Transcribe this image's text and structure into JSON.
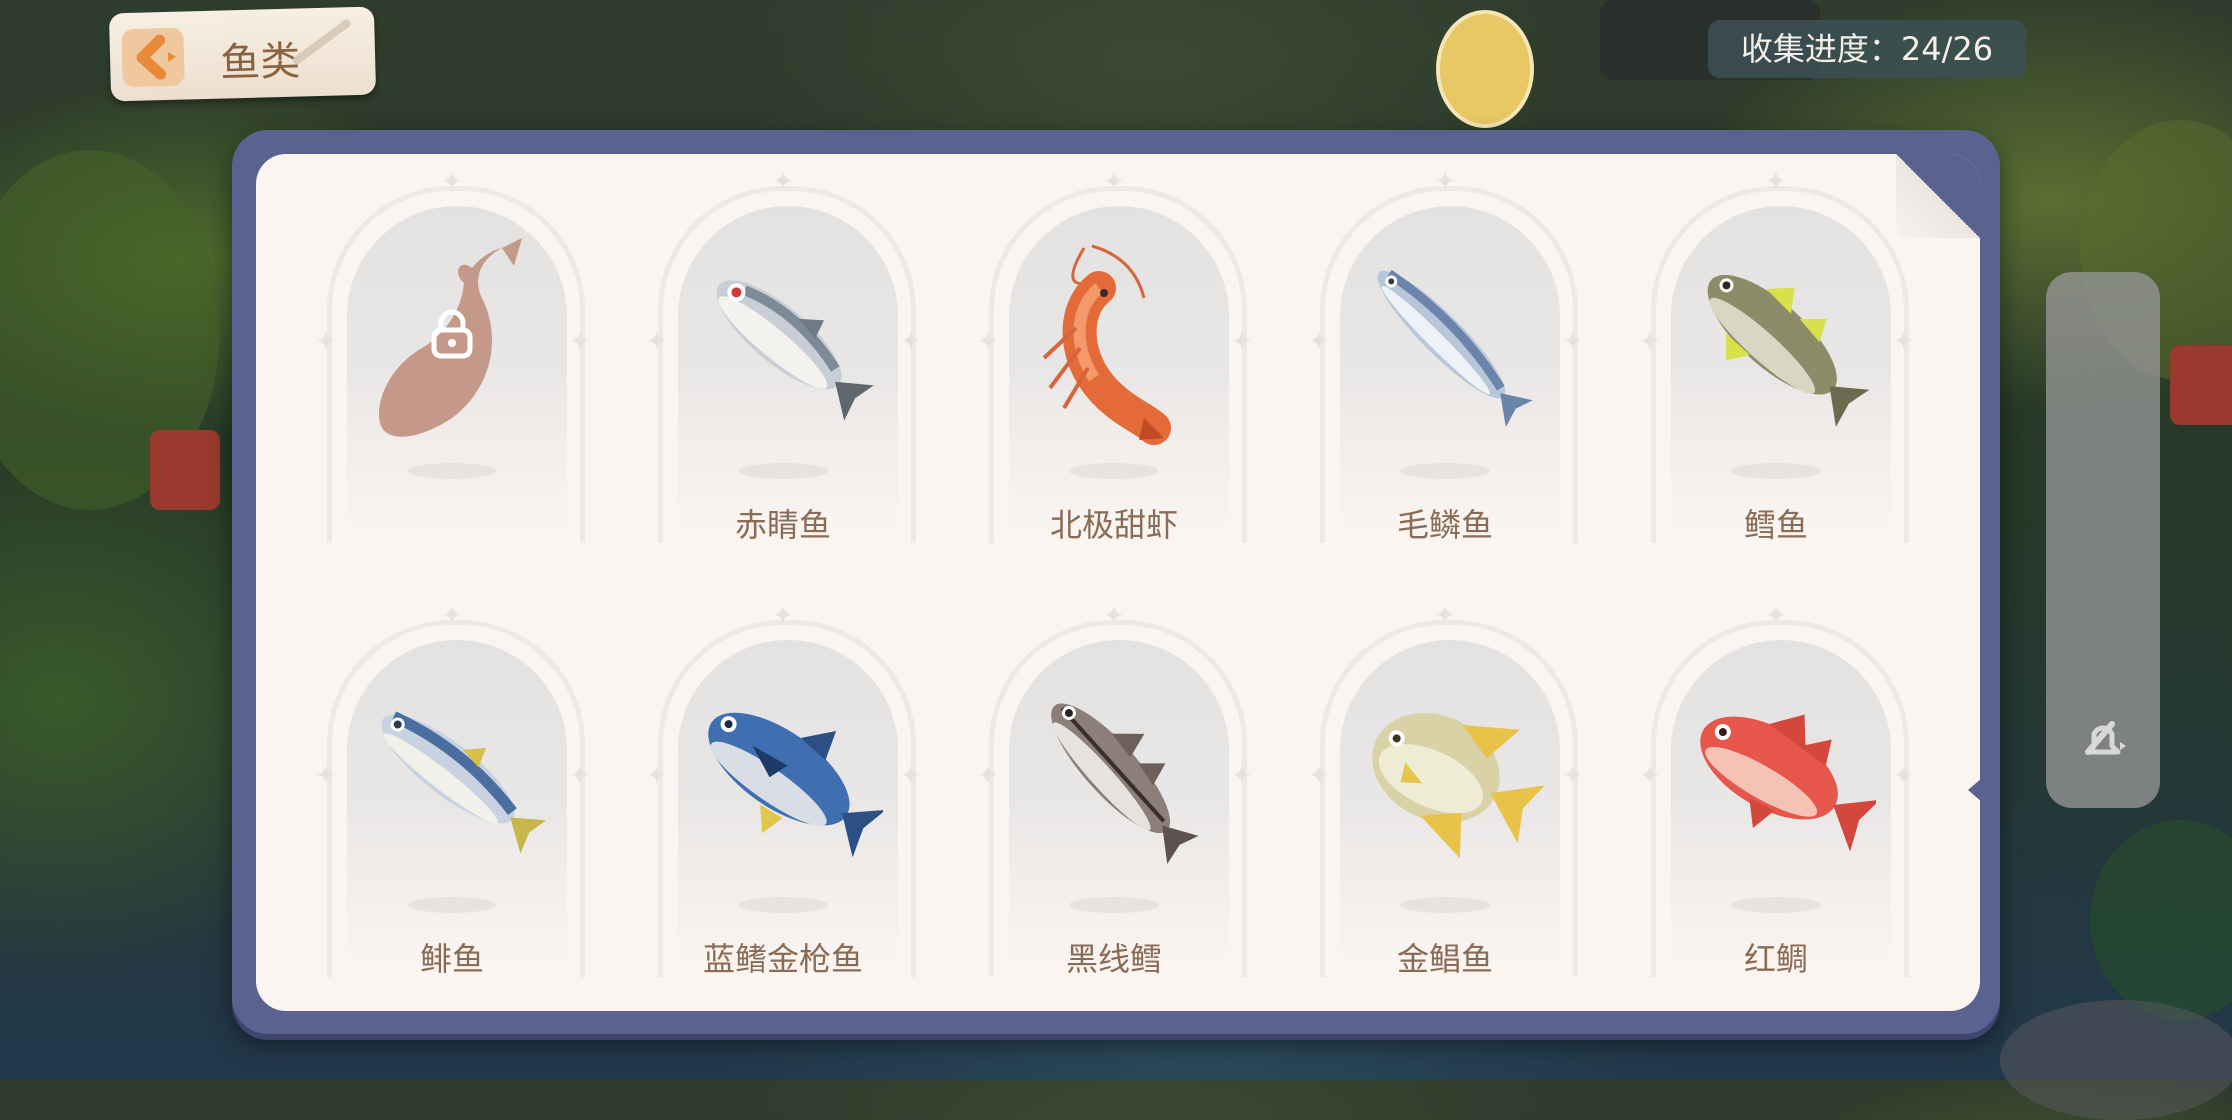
{
  "header": {
    "category_title": "鱼类",
    "progress_text": "收集进度：24/26"
  },
  "fish_cards": [
    {
      "name": "",
      "icon": "lock-icon",
      "locked": true,
      "color": "#c4998a"
    },
    {
      "name": "赤睛鱼",
      "icon": "red-eye-fish-icon",
      "locked": false,
      "color": "#9aa0a8"
    },
    {
      "name": "北极甜虾",
      "icon": "shrimp-icon",
      "locked": false,
      "color": "#e56a3a"
    },
    {
      "name": "毛鳞鱼",
      "icon": "capelin-icon",
      "locked": false,
      "color": "#7f98b8"
    },
    {
      "name": "鳕鱼",
      "icon": "cod-icon",
      "locked": false,
      "color": "#8a8a62"
    },
    {
      "name": "鲱鱼",
      "icon": "herring-icon",
      "locked": false,
      "color": "#6f8ab0"
    },
    {
      "name": "蓝鳍金枪鱼",
      "icon": "bluefin-tuna-icon",
      "locked": false,
      "color": "#3f6fb0"
    },
    {
      "name": "黑线鳕",
      "icon": "haddock-icon",
      "locked": false,
      "color": "#7d6e6a"
    },
    {
      "name": "金鲳鱼",
      "icon": "golden-pompano-icon",
      "locked": false,
      "color": "#e8c34a"
    },
    {
      "name": "红鲷",
      "icon": "red-snapper-icon",
      "locked": false,
      "color": "#e6564a"
    }
  ],
  "colors": {
    "panel_border": "#5a628f",
    "panel_bg": "#faf5f1",
    "label_text": "#8a6b55",
    "back_accent": "#e88a3a"
  }
}
